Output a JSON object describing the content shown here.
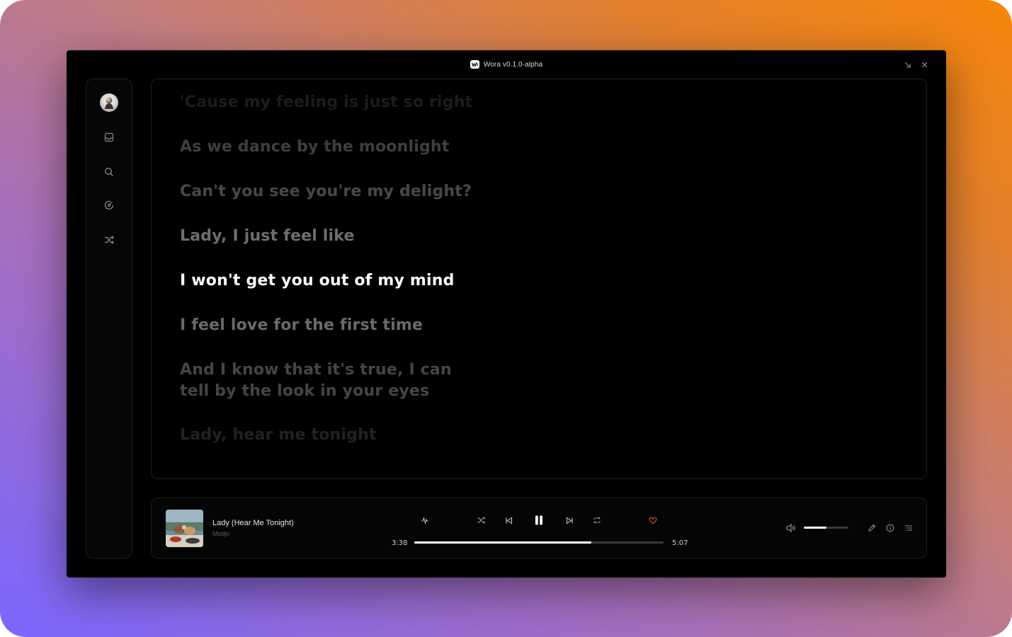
{
  "window": {
    "title": "Wora v0.1.0-alpha"
  },
  "sidebar": {
    "items": [
      {
        "name": "avatar"
      },
      {
        "name": "inbox-icon"
      },
      {
        "name": "search-icon"
      },
      {
        "name": "disc-icon"
      },
      {
        "name": "shuffle-icon"
      }
    ]
  },
  "lyrics": {
    "lines": [
      {
        "text": "'Cause my feeling is just so right",
        "state": "faded"
      },
      {
        "text": "As we dance by the moonlight",
        "state": "dim"
      },
      {
        "text": "Can't you see you're my delight?",
        "state": "dim"
      },
      {
        "text": "Lady, I just feel like",
        "state": "near"
      },
      {
        "text": "I won't get you out of my mind",
        "state": "active"
      },
      {
        "text": "I feel love for the first time",
        "state": "near"
      },
      {
        "text": "And I know that it's true, I can",
        "state": "dim"
      },
      {
        "text": "tell by the look in your eyes",
        "state": "dim"
      },
      {
        "text": "Lady, hear me tonight",
        "state": "faded"
      }
    ]
  },
  "player": {
    "song_title": "Lady (Hear Me Tonight)",
    "artist": "Modjo",
    "current_time": "3:38",
    "total_time": "5:07",
    "progress_fraction": 0.709,
    "volume_fraction": 0.5,
    "is_playing": true,
    "is_favorite": true,
    "colors": {
      "accent": "#ffffff",
      "favorite": "#e0382f"
    }
  }
}
